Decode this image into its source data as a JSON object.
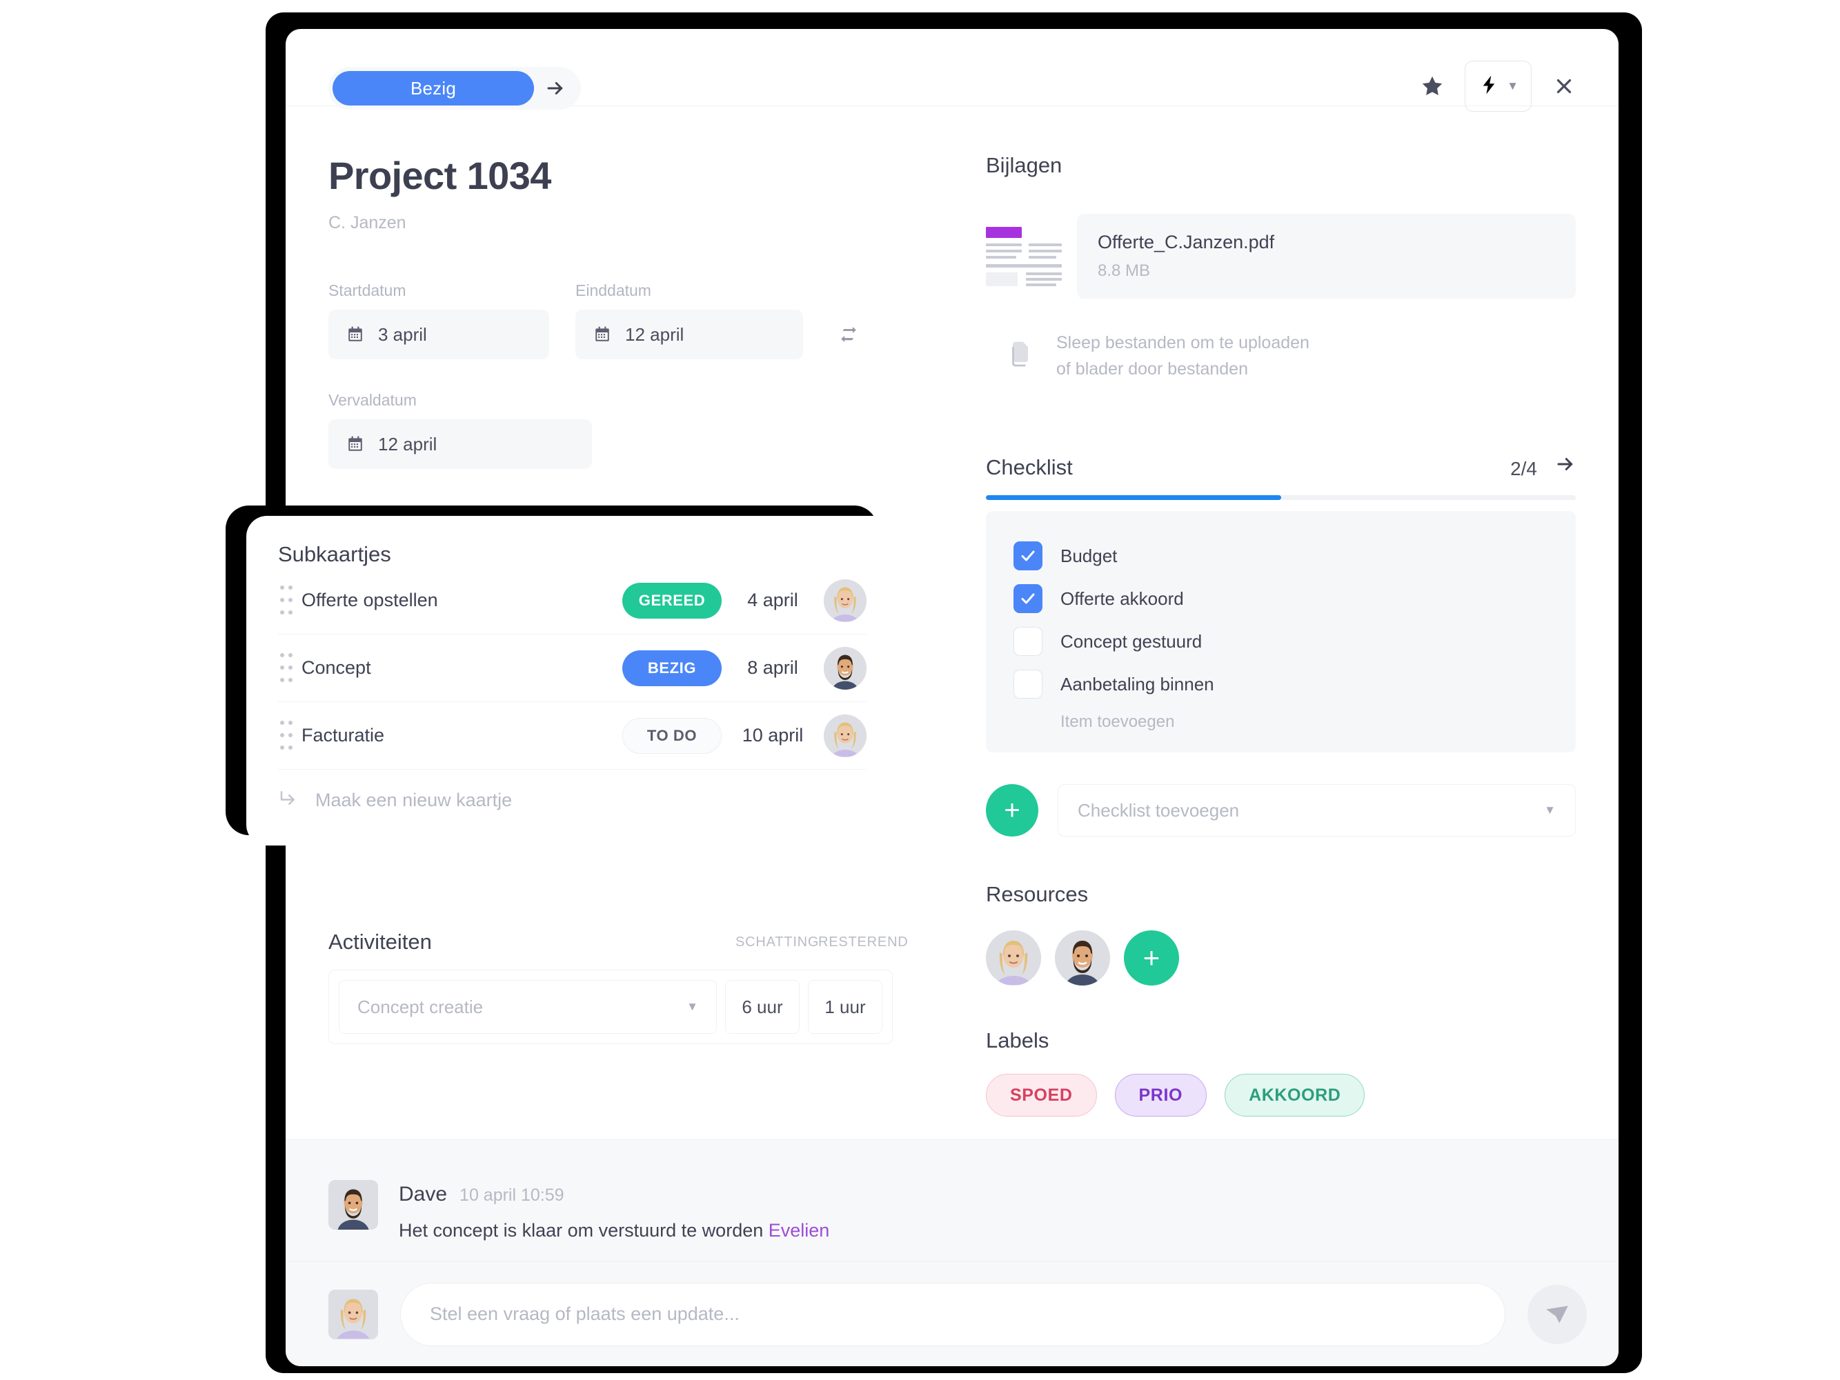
{
  "header": {
    "status_label": "Bezig",
    "next_status_icon": "arrow-right-icon",
    "star_icon": "star-icon",
    "bolt_icon": "lightning-bolt-icon",
    "chevron_icon": "chevron-down-icon",
    "close_icon": "close-icon"
  },
  "project": {
    "title": "Project 1034",
    "client": "C. Janzen"
  },
  "dates": {
    "start_label": "Startdatum",
    "start_value": "3 april",
    "end_label": "Einddatum",
    "end_value": "12 april",
    "due_label": "Vervaldatum",
    "due_value": "12 april",
    "swap_icon": "swap-arrows-icon"
  },
  "subcards": {
    "title": "Subkaartjes",
    "rows": [
      {
        "name": "Offerte opstellen",
        "status": "GEREED",
        "status_type": "done",
        "date": "4 april"
      },
      {
        "name": "Concept",
        "status": "BEZIG",
        "status_type": "busy",
        "date": "8 april"
      },
      {
        "name": "Facturatie",
        "status": "TO DO",
        "status_type": "todo",
        "date": "10 april"
      }
    ],
    "new_card_label": "Maak een nieuw kaartje"
  },
  "activities": {
    "title": "Activiteiten",
    "col_estimate": "SCHATTING",
    "col_remaining": "RESTEREND",
    "row": {
      "name": "Concept creatie",
      "estimate": "6 uur",
      "remaining": "1 uur"
    }
  },
  "attachments": {
    "title": "Bijlagen",
    "file_name": "Offerte_C.Janzen.pdf",
    "file_size": "8.8 MB",
    "drop_line1": "Sleep bestanden om te uploaden",
    "drop_line2": "of blader door bestanden",
    "drop_icon": "documents-icon"
  },
  "checklist": {
    "title": "Checklist",
    "count": "2/4",
    "progress_percent": 50,
    "next_icon": "arrow-right-icon",
    "items": [
      {
        "label": "Budget",
        "checked": true
      },
      {
        "label": "Offerte akkoord",
        "checked": true
      },
      {
        "label": "Concept gestuurd",
        "checked": false
      },
      {
        "label": "Aanbetaling binnen",
        "checked": false
      }
    ],
    "add_item_label": "Item toevoegen",
    "add_checklist_placeholder": "Checklist toevoegen",
    "add_button_icon": "plus-icon"
  },
  "resources": {
    "title": "Resources",
    "add_icon": "plus-icon",
    "people": [
      "Evelien",
      "Dave"
    ]
  },
  "labels": {
    "title": "Labels",
    "items": [
      {
        "text": "SPOED",
        "bg": "#fdeaee",
        "fg": "#d6405f",
        "border": "#f5c3cf"
      },
      {
        "text": "PRIO",
        "bg": "#ece2fb",
        "fg": "#7b35c9",
        "border": "#c8a6f0"
      },
      {
        "text": "AKKOORD",
        "bg": "#e2f7ef",
        "fg": "#2b9e7b",
        "border": "#8fdcc2"
      }
    ]
  },
  "comments": {
    "author": "Dave",
    "time": "10 april 10:59",
    "text": "Het concept is klaar om verstuurd te worden ",
    "mention": "Evelien",
    "composer_placeholder": "Stel een vraag of plaats een update...",
    "send_icon": "send-icon"
  }
}
